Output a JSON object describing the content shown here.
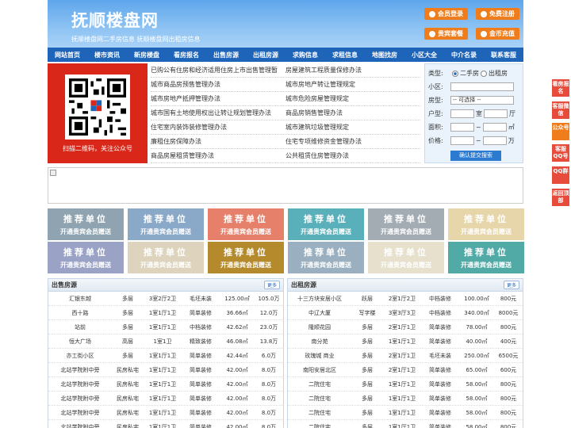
{
  "header": {
    "logo": "抚顺楼盘网",
    "tagline": "抚顺楼盘网二手房信息  抚顺楼盘网出租房信息",
    "buttons": [
      "会员登录",
      "免费注册",
      "贵宾套餐",
      "金币充值"
    ]
  },
  "nav": [
    "网站首页",
    "楼市资讯",
    "新房楼盘",
    "看房报名",
    "出售房源",
    "出租房源",
    "求购信息",
    "求租信息",
    "地图找房",
    "小区大全",
    "中介名录",
    "联系客服"
  ],
  "qr": {
    "caption": "扫描二维码，关注公众号"
  },
  "links": [
    [
      "已购公有住房和经济适用住房上市出售管理暂",
      "房屋建筑工程质量保修办法"
    ],
    [
      "城市商品房预售管理办法",
      "城市房地产转让管理规定"
    ],
    [
      "城市房地产抵押管理办法",
      "城市危险房屋管理规定"
    ],
    [
      "城市国有土地使用权出让转让规划管理办法",
      "商品房销售管理办法"
    ],
    [
      "住宅室内装饰装修管理办法",
      "城市建筑垃圾管理规定"
    ],
    [
      "廉租住房保障办法",
      "住宅专项维修资金管理办法"
    ],
    [
      "商品房屋租赁管理办法",
      "公共租赁住房管理办法"
    ]
  ],
  "search": {
    "type_label": "类型:",
    "type_options": [
      "二手房",
      "出租房"
    ],
    "district_label": "小区:",
    "room_type_label": "房型:",
    "room_type_value": "-- 可选择 --",
    "layout_label": "户型:",
    "room_unit": "室",
    "hall_unit": "厅",
    "area_label": "面积:",
    "area_unit": "㎡",
    "price_label": "价格:",
    "price_unit": "万",
    "range_sep": "~",
    "submit": "确认提交搜索"
  },
  "recommend": {
    "title": "推荐单位",
    "subtitle": "开通贵宾会员赠送",
    "colors": [
      "#8fa4b0",
      "#8aa9c8",
      "#e6806a",
      "#5ab0ba",
      "#a3abb3",
      "#e6d6aa",
      "#9aa3c6",
      "#ded4bd",
      "#b58a2c",
      "#9ab0c0",
      "#e6e0cc",
      "#52aaa6"
    ]
  },
  "sale": {
    "title": "出售房源",
    "more": "更多",
    "rows": [
      [
        "汇银东越",
        "多层",
        "3室2厅2卫",
        "毛坯未装",
        "125.00㎡",
        "105.0万"
      ],
      [
        "西十路",
        "多层",
        "1室1厅1卫",
        "简单装修",
        "36.66㎡",
        "12.0万"
      ],
      [
        "站前",
        "多层",
        "1室1厅1卫",
        "中档装修",
        "42.62㎡",
        "23.0万"
      ],
      [
        "恒大广场",
        "高层",
        "1室1卫",
        "精致装修",
        "46.08㎡",
        "13.8万"
      ],
      [
        "亦工街小区",
        "多层",
        "1室1厅1卫",
        "简单装修",
        "42.44㎡",
        "6.0万"
      ],
      [
        "北站学院附中旁",
        "民房私宅",
        "1室1厅1卫",
        "简单装修",
        "42.00㎡",
        "8.0万"
      ],
      [
        "北站学院附中旁",
        "民房私宅",
        "1室1厅1卫",
        "简单装修",
        "42.00㎡",
        "8.0万"
      ],
      [
        "北站学院附中旁",
        "民房私宅",
        "1室1厅1卫",
        "简单装修",
        "42.00㎡",
        "8.0万"
      ],
      [
        "北站学院附中旁",
        "民房私宅",
        "1室1厅1卫",
        "简单装修",
        "42.00㎡",
        "8.0万"
      ],
      [
        "北站学院附中旁",
        "民房私宅",
        "1室1厅1卫",
        "简单装修",
        "42.00㎡",
        "8.0万"
      ]
    ]
  },
  "rent": {
    "title": "出租房源",
    "more": "更多",
    "rows": [
      [
        "十三方块安居小区",
        "跃层",
        "2室1厅2卫",
        "中档装修",
        "100.00㎡",
        "800元"
      ],
      [
        "中辽大厦",
        "写字楼",
        "3室3厅3卫",
        "中档装修",
        "340.00㎡",
        "8000元"
      ],
      [
        "隆顺花园",
        "多层",
        "2室1厅1卫",
        "简单装修",
        "78.00㎡",
        "800元"
      ],
      [
        "南分苑",
        "多层",
        "1室1厅1卫",
        "简单装修",
        "40.00㎡",
        "400元"
      ],
      [
        "玫瑰城 商业",
        "多层",
        "2室1厅1卫",
        "毛坯未装",
        "250.00㎡",
        "6500元"
      ],
      [
        "南阳安居北区",
        "多层",
        "2室1厅1卫",
        "简单装修",
        "65.00㎡",
        "600元"
      ],
      [
        "二院住宅",
        "多层",
        "1室1厅1卫",
        "简单装修",
        "58.00㎡",
        "800元"
      ],
      [
        "二院住宅",
        "多层",
        "1室1厅1卫",
        "简单装修",
        "58.00㎡",
        "800元"
      ],
      [
        "二院住宅",
        "多层",
        "1室1厅1卫",
        "简单装修",
        "58.00㎡",
        "800元"
      ],
      [
        "二院住宅",
        "多层",
        "1室1厅1卫",
        "简单装修",
        "58.00㎡",
        "800元"
      ]
    ]
  },
  "sidebar": [
    "看房报名",
    "客服微信",
    "公众号",
    "客服QQ号",
    "QQ群",
    "返回顶部"
  ]
}
